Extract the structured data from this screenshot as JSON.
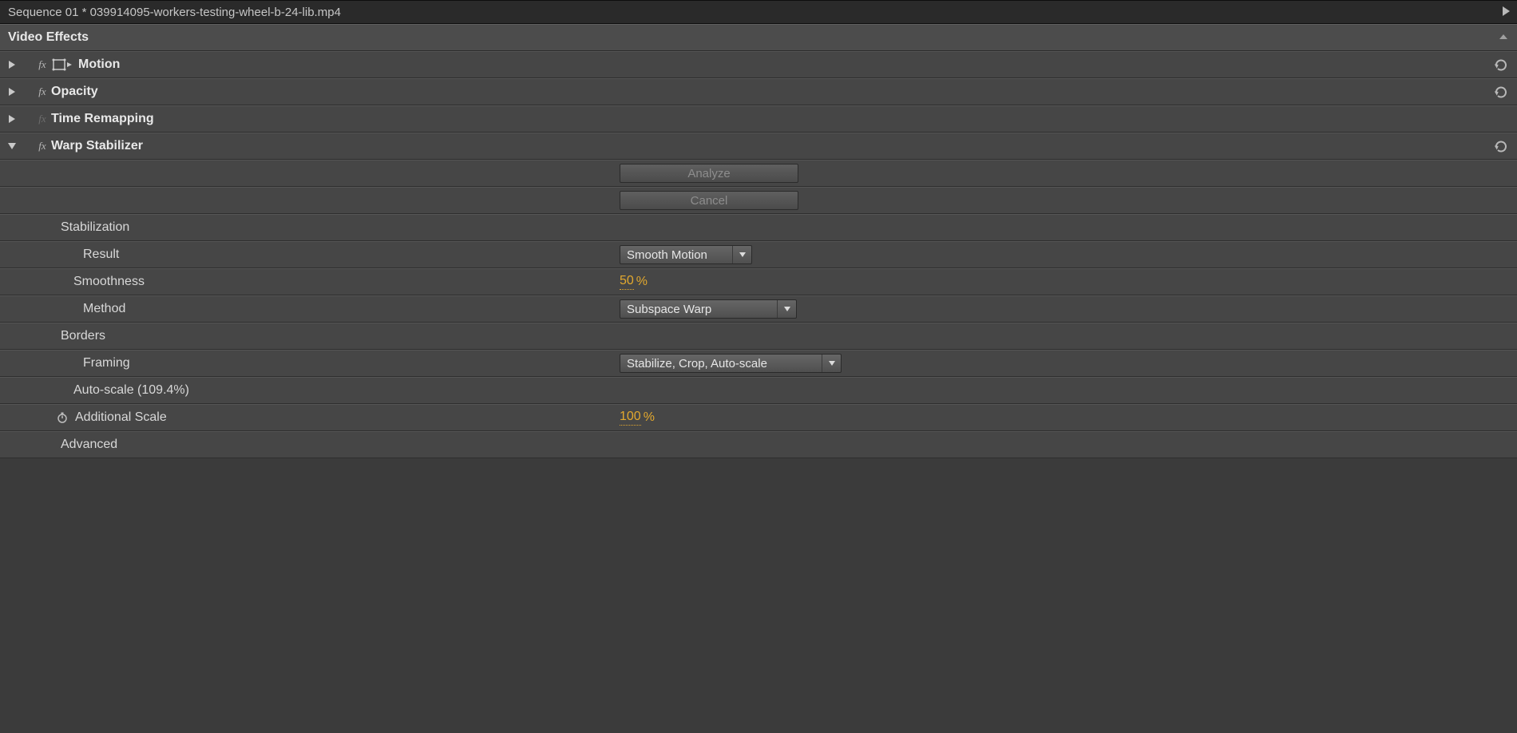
{
  "title_bar": "Sequence 01 * 039914095-workers-testing-wheel-b-24-lib.mp4",
  "section_header": "Video Effects",
  "effects": {
    "motion": "Motion",
    "opacity": "Opacity",
    "time_remapping": "Time Remapping",
    "warp": "Warp Stabilizer"
  },
  "warp": {
    "analyze_btn": "Analyze",
    "cancel_btn": "Cancel",
    "stabilization_label": "Stabilization",
    "result_label": "Result",
    "result_value": "Smooth Motion",
    "smoothness_label": "Smoothness",
    "smoothness_value": "50",
    "smoothness_unit": "%",
    "method_label": "Method",
    "method_value": "Subspace Warp",
    "borders_label": "Borders",
    "framing_label": "Framing",
    "framing_value": "Stabilize, Crop, Auto-scale",
    "autoscale_label": "Auto-scale (109.4%)",
    "addscale_label": "Additional Scale",
    "addscale_value": "100",
    "addscale_unit": "%",
    "advanced_label": "Advanced"
  }
}
